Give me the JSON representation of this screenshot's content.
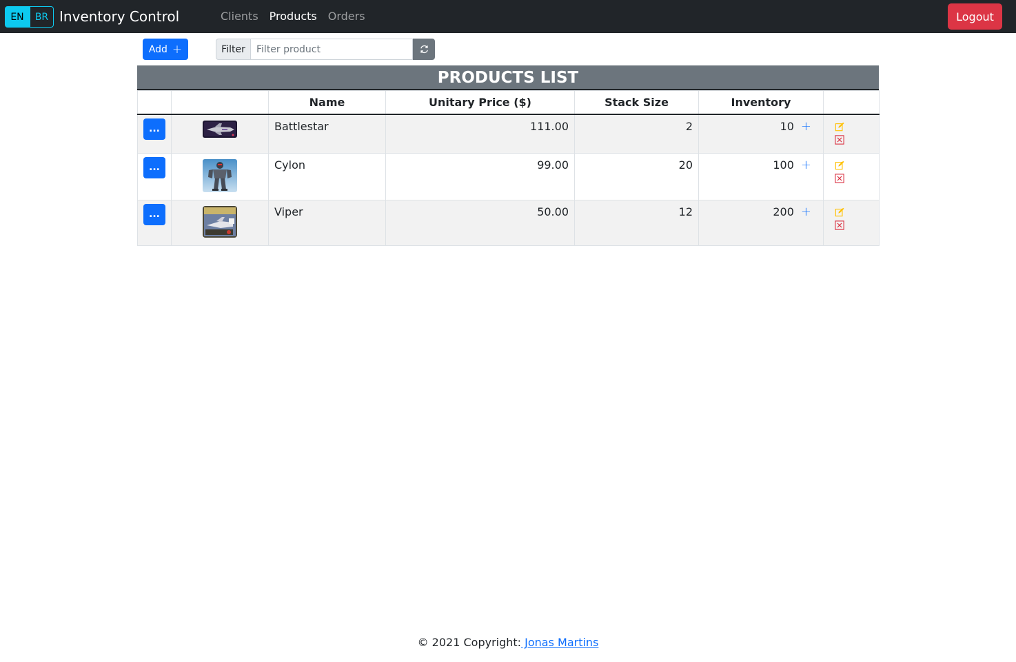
{
  "nav": {
    "lang_en": "EN",
    "lang_br": "BR",
    "brand": "Inventory Control",
    "links": [
      {
        "label": "Clients",
        "active": false
      },
      {
        "label": "Products",
        "active": true
      },
      {
        "label": "Orders",
        "active": false
      }
    ],
    "logout": "Logout"
  },
  "toolbar": {
    "add_label": "Add",
    "add_icon": "plus-icon",
    "filter_label": "Filter",
    "filter_placeholder": "Filter product",
    "filter_value": "",
    "refresh_icon": "refresh-icon"
  },
  "table": {
    "title": "PRODUCTS LIST",
    "headers": [
      "",
      "",
      "Name",
      "Unitary Price ($)",
      "Stack Size",
      "Inventory",
      ""
    ],
    "rows": [
      {
        "menu": "...",
        "image": "battlestar-thumbnail",
        "name": "Battlestar",
        "price": "111.00",
        "stack": "2",
        "inventory": "10"
      },
      {
        "menu": "...",
        "image": "cylon-thumbnail",
        "name": "Cylon",
        "price": "99.00",
        "stack": "20",
        "inventory": "100"
      },
      {
        "menu": "...",
        "image": "viper-thumbnail",
        "name": "Viper",
        "price": "50.00",
        "stack": "12",
        "inventory": "200"
      }
    ],
    "inventory_add_icon": "plus-icon",
    "edit_icon": "pencil-square-icon",
    "delete_icon": "x-square-icon"
  },
  "footer": {
    "prefix": "© 2021 Copyright:",
    "author": " Jonas Martins"
  },
  "colors": {
    "navbar": "#212529",
    "primary": "#0d6efd",
    "danger": "#dc3545",
    "info": "#0dcaf0",
    "secondary": "#6c757d",
    "warning": "#ffc107"
  }
}
